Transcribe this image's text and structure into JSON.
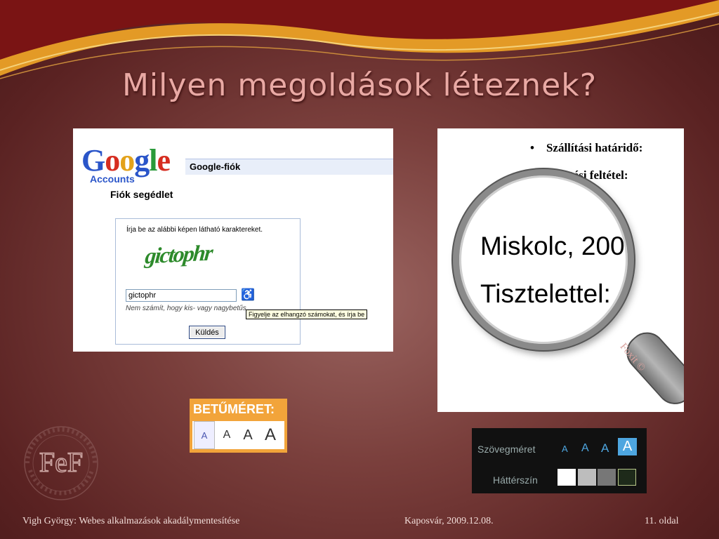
{
  "slide": {
    "title": "Milyen megoldások léteznek?"
  },
  "google": {
    "logo": "Google",
    "accounts": "Accounts",
    "bar_title": "Google-fiók",
    "subtitle": "Fiók segédlet",
    "instruction": "Írja be az alábbi képen látható karaktereket.",
    "captcha_text": "gictophr",
    "input_value": "gictophr",
    "note": "Nem számít, hogy kis- vagy nagybetűs",
    "tooltip": "Figyelje az elhangzó számokat, és írja be",
    "submit_label": "Küldés"
  },
  "magnifier": {
    "bullet1": "Szállítási határidő:",
    "bullet2": "tési feltétel:",
    "line1": "Miskolc, 200",
    "line2": "Tisztelettel:",
    "watermark": "Foxit ©"
  },
  "font_widget": {
    "title": "BETŰMÉRET:",
    "sizes": [
      "A",
      "A",
      "A",
      "A"
    ]
  },
  "text_widget": {
    "size_label": "Szövegméret",
    "bg_label": "Háttérszín",
    "sizes": [
      "A",
      "A",
      "A",
      "A"
    ],
    "colors": [
      "#ffffff",
      "#bdbdbd",
      "#777777",
      "#1e2a1a"
    ]
  },
  "footer": {
    "author": "Vigh György: Webes alkalmazások akadálymentesítése",
    "place_date": "Kaposvár, 2009.12.08.",
    "page": "11. oldal"
  }
}
